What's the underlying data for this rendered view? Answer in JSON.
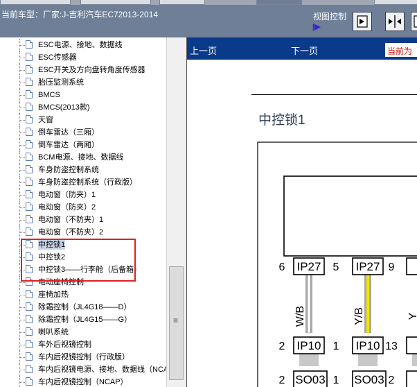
{
  "header": {
    "vehicle_title": "当前车型：厂家:J-吉利汽车EC72013-2014",
    "view_control_label": "视图控制",
    "view_indicator": "|▶",
    "view_buttons": [
      "fit-width-icon",
      "fit-page-icon",
      "toggle-panel-icon"
    ]
  },
  "tree": {
    "items": [
      {
        "label": "ESC电源、接地、数据线"
      },
      {
        "label": "ESC传感器"
      },
      {
        "label": "ESC开关及方向盘转角度传感器"
      },
      {
        "label": "胎压监测系统"
      },
      {
        "label": "BMCS"
      },
      {
        "label": "BMCS(2013款)"
      },
      {
        "label": "天窗"
      },
      {
        "label": "倒车雷达（三厢）"
      },
      {
        "label": "倒车雷达（两厢）"
      },
      {
        "label": "BCM电源、接地、数据线"
      },
      {
        "label": "车身防盗控制系统"
      },
      {
        "label": "车身防盗控制系统（行政版）"
      },
      {
        "label": "电动窗（防夹）1"
      },
      {
        "label": "电动窗（防夹）2"
      },
      {
        "label": "电动窗（不防夹）1"
      },
      {
        "label": "电动窗（不防夹）2"
      },
      {
        "label": "中控锁1"
      },
      {
        "label": "中控锁2"
      },
      {
        "label": "中控锁3——行李舱（后备箱）"
      },
      {
        "label": "电动座椅控制"
      },
      {
        "label": "座椅加热"
      },
      {
        "label": "除霜控制（JL4G18——D）"
      },
      {
        "label": "除霜控制（JL4G15——G）"
      },
      {
        "label": "喇叭系统"
      },
      {
        "label": "车外后视镜控制"
      },
      {
        "label": "车内后视镜控制（行政版）"
      },
      {
        "label": "车内后视镜电源、接地、数据线（NCAP）"
      },
      {
        "label": "车内后视镜控制（NCAP）"
      }
    ],
    "selected_index": 16
  },
  "content": {
    "prev_label": "上一页",
    "next_label": "下一页",
    "current_label": "当前为",
    "page_title": "中控锁1"
  },
  "diagram": {
    "top_pins": [
      {
        "pin": "6",
        "connector": "IP27",
        "wire": "W/B",
        "wire_color": "#ffffff"
      },
      {
        "pin": "5",
        "connector": "IP27",
        "wire": "Y/B",
        "wire_color": "#f2e500"
      },
      {
        "pin": "9",
        "connector": "IP",
        "wire": "Y",
        "wire_color": "#f2e500"
      }
    ],
    "mid_pins": [
      {
        "pin": "2",
        "connector": "IP10"
      },
      {
        "pin": "1",
        "connector": "IP10"
      },
      {
        "pin": "13",
        "connector": "IP"
      }
    ],
    "bottom_pins": [
      {
        "pin": "2",
        "connector": "SO03"
      },
      {
        "pin": "1",
        "connector": "SO03"
      },
      {
        "pin": "2",
        "connector": "S"
      }
    ]
  }
}
